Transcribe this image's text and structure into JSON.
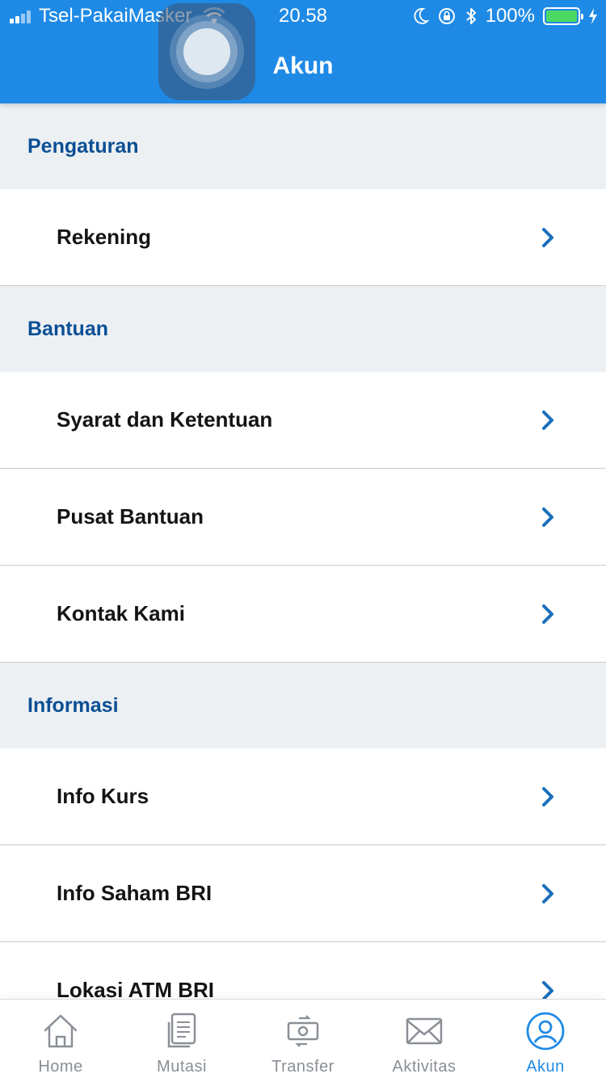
{
  "status_bar": {
    "carrier": "Tsel-PakaiMasker",
    "time": "20.58",
    "battery": "100%"
  },
  "header": {
    "title": "Akun"
  },
  "sections": [
    {
      "title": "Pengaturan",
      "items": [
        "Rekening"
      ]
    },
    {
      "title": "Bantuan",
      "items": [
        "Syarat dan Ketentuan",
        "Pusat Bantuan",
        "Kontak Kami"
      ]
    },
    {
      "title": "Informasi",
      "items": [
        "Info Kurs",
        "Info Saham BRI",
        "Lokasi ATM BRI"
      ]
    }
  ],
  "tabs": [
    "Home",
    "Mutasi",
    "Transfer",
    "Aktivitas",
    "Akun"
  ],
  "colors": {
    "primary": "#1f8ae6",
    "section_text": "#0b4f94",
    "section_bg": "#ecf0f3",
    "inactive": "#8a8f96"
  }
}
